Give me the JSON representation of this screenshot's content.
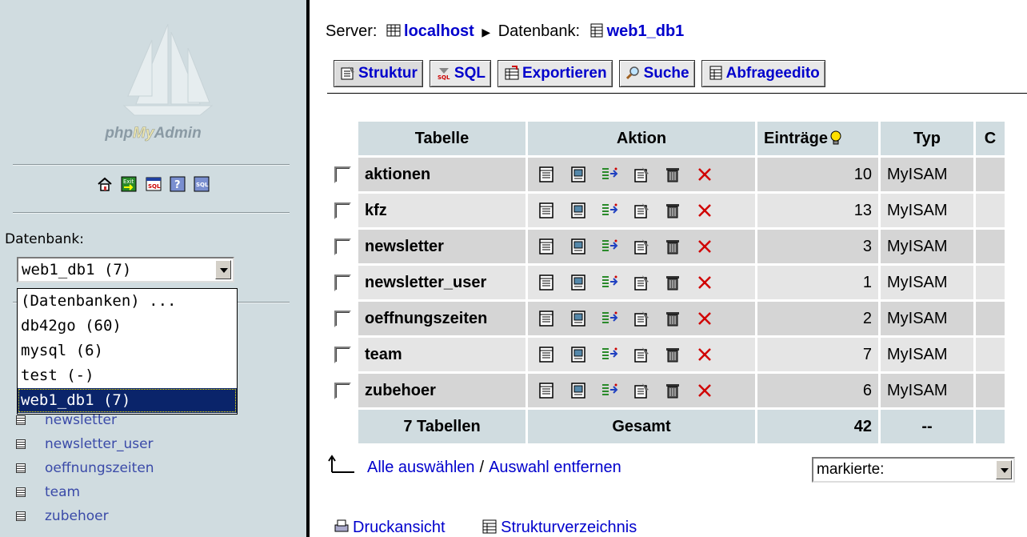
{
  "left": {
    "logo": "phpMyAdmin",
    "db_label": "Datenbank:",
    "db_select_value": "web1_db1 (7)",
    "db_options": [
      "(Datenbanken) ...",
      "db42go (60)",
      "mysql (6)",
      "test (-)",
      "web1_db1 (7)"
    ],
    "db_selected_index": 4,
    "table_list": [
      "newsletter",
      "newsletter_user",
      "oeffnungszeiten",
      "team",
      "zubehoer"
    ],
    "icons": [
      "home-icon",
      "exit-icon",
      "sql-icon",
      "help-icon",
      "sql-docs-icon"
    ]
  },
  "breadcrumb": {
    "server_label": "Server:",
    "server": "localhost",
    "sep": "▶",
    "db_label": "Datenbank:",
    "db": "web1_db1"
  },
  "tabs": [
    "Struktur",
    "SQL",
    "Exportieren",
    "Suche",
    "Abfrageedito"
  ],
  "table": {
    "headers": [
      "Tabelle",
      "Aktion",
      "Einträge",
      "Typ",
      "C"
    ],
    "rows": [
      {
        "name": "aktionen",
        "entries": "10",
        "type": "MyISAM"
      },
      {
        "name": "kfz",
        "entries": "13",
        "type": "MyISAM"
      },
      {
        "name": "newsletter",
        "entries": "3",
        "type": "MyISAM"
      },
      {
        "name": "newsletter_user",
        "entries": "1",
        "type": "MyISAM"
      },
      {
        "name": "oeffnungszeiten",
        "entries": "2",
        "type": "MyISAM"
      },
      {
        "name": "team",
        "entries": "7",
        "type": "MyISAM"
      },
      {
        "name": "zubehoer",
        "entries": "6",
        "type": "MyISAM"
      }
    ],
    "footer": {
      "tables": "7 Tabellen",
      "total_label": "Gesamt",
      "entries": "42",
      "type": "--"
    }
  },
  "select_all": "Alle auswählen",
  "select_sep": "/",
  "deselect_all": "Auswahl entfernen",
  "with_selected": "markierte:",
  "bottom_links": [
    "Druckansicht",
    "Strukturverzeichnis"
  ],
  "colors": {
    "link": "#0000cc",
    "left_bg": "#d0dce0",
    "row_odd": "#d5d5d5",
    "row_even": "#e5e5e5",
    "selected": "#0a246a"
  }
}
